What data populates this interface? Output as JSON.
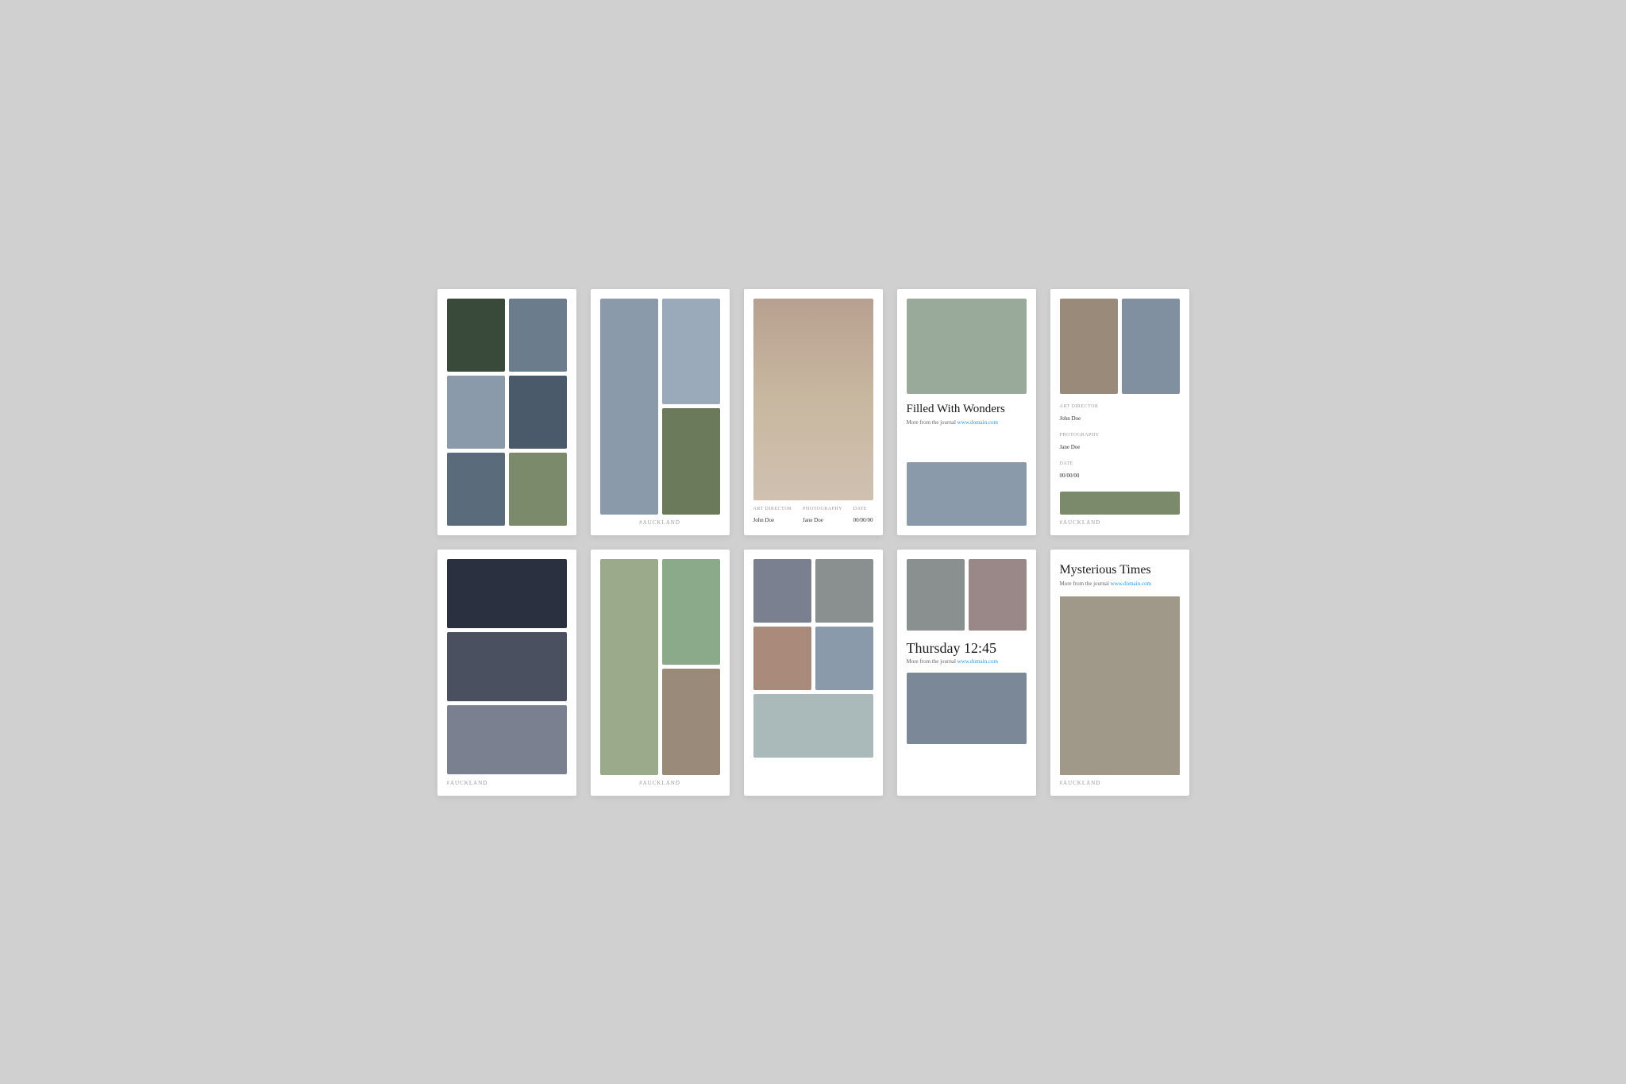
{
  "cards": [
    {
      "id": "card-1",
      "type": "photo-grid-6",
      "photos": [
        "dark-forest",
        "woman-sitting",
        "woman-smile",
        "woman-denim",
        "woman-field",
        "mountain-dark"
      ]
    },
    {
      "id": "card-2",
      "type": "waterfall",
      "label": "#AUCKLAND",
      "photos": [
        "waterfall",
        "waterfall2",
        "forest-bridge",
        "forest-autumn"
      ]
    },
    {
      "id": "card-3",
      "type": "portrait-info",
      "art_director_label": "Art Director",
      "art_director_value": "John Doe",
      "photography_label": "Photography",
      "photography_value": "Jane Doe",
      "date_label": "Date",
      "date_value": "00/00/00"
    },
    {
      "id": "card-4",
      "type": "filled-with-wonders",
      "title": "Filled With Wonders",
      "subtitle": "More from the journal",
      "link": "www.domain.com"
    },
    {
      "id": "card-5",
      "type": "art-director",
      "art_director_label": "Art Director",
      "art_director_value": "John Doe",
      "photography_label": "Photography",
      "photography_value": "Jane Doe",
      "date_label": "Date",
      "date_value": "00/00/00",
      "label": "#AUCKLAND"
    },
    {
      "id": "card-6",
      "type": "dark-photos",
      "label": "#AUCKLAND"
    },
    {
      "id": "card-7",
      "type": "outdoor-grid",
      "label": "#AUCKLAND"
    },
    {
      "id": "card-8",
      "type": "rocks-water"
    },
    {
      "id": "card-9",
      "type": "thursday",
      "title": "Thursday 12:45",
      "subtitle": "More from the journal",
      "link": "www.domain.com"
    },
    {
      "id": "card-10",
      "type": "mysterious-times",
      "title": "Mysterious Times",
      "subtitle": "More from the journal",
      "link": "www.domain.com",
      "label": "#AUCKLAND"
    }
  ]
}
